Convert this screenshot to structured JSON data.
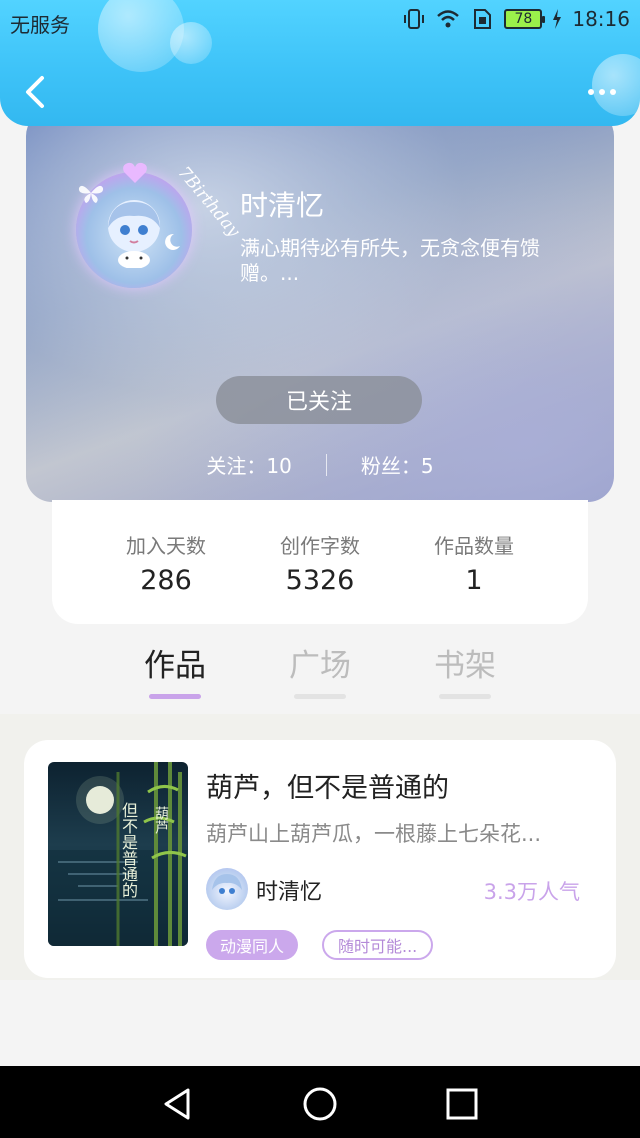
{
  "status_bar": {
    "carrier": "无服务",
    "battery": "78",
    "time": "18:16"
  },
  "profile": {
    "avatar_badge_text": "7Birthday",
    "username": "时清忆",
    "bio": "满心期待必有所失，无贪念便有馈赠。...",
    "follow_button": "已关注",
    "following_label": "关注：10",
    "followers_label": "粉丝：5"
  },
  "stats": [
    {
      "label": "加入天数",
      "value": "286"
    },
    {
      "label": "创作字数",
      "value": "5326"
    },
    {
      "label": "作品数量",
      "value": "1"
    }
  ],
  "tabs": [
    {
      "label": "作品",
      "active": true
    },
    {
      "label": "广场",
      "active": false
    },
    {
      "label": "书架",
      "active": false
    }
  ],
  "work": {
    "title": "葫芦，但不是普通的",
    "description": "葫芦山上葫芦瓜，一根藤上七朵花...",
    "cover_text_left": "但不是普通的",
    "cover_text_right": "葫芦",
    "author": "时清忆",
    "popularity": "3.3万人气",
    "tags": [
      "动漫同人",
      "随时可能..."
    ]
  },
  "colors": {
    "header": "#3ec3f8",
    "accent": "#c9a3ea",
    "background": "#f4f4f4"
  },
  "icons": {
    "back": "chevron-left-icon",
    "more": "more-dots-icon",
    "nav_back": "triangle-back-icon",
    "nav_home": "circle-home-icon",
    "nav_recent": "square-recent-icon"
  }
}
